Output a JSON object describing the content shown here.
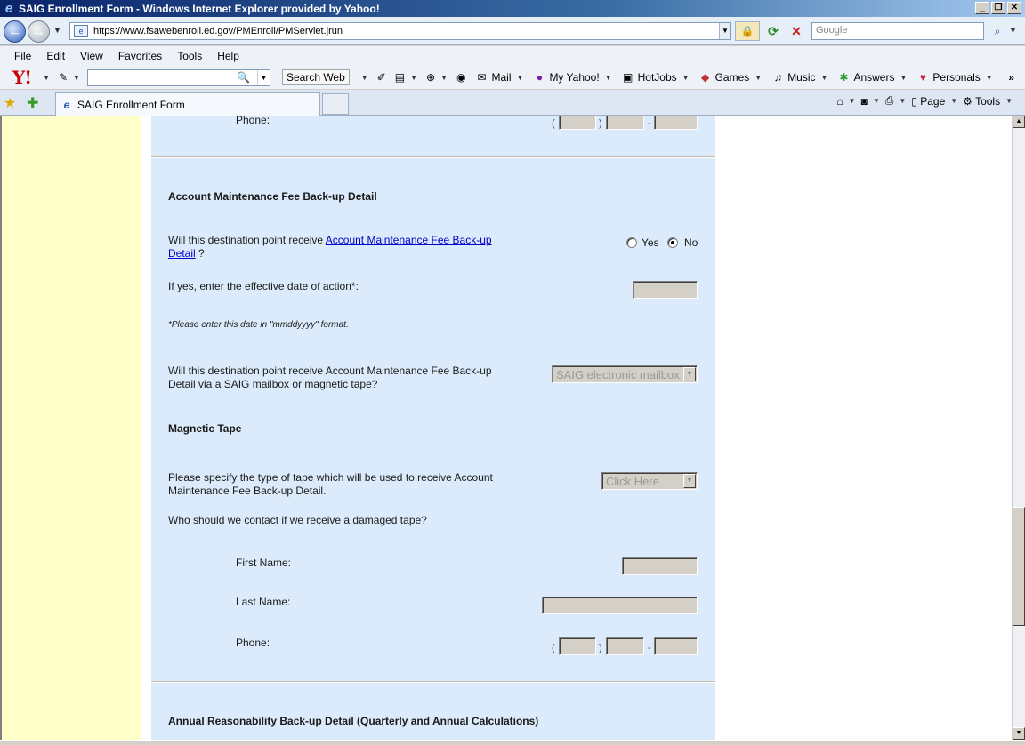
{
  "window": {
    "title": "SAIG Enrollment Form - Windows Internet Explorer provided by Yahoo!"
  },
  "address": {
    "url": "https://www.fsawebenroll.ed.gov/PMEnroll/PMServlet.jrun",
    "search_placeholder": "Google"
  },
  "menu": [
    "File",
    "Edit",
    "View",
    "Favorites",
    "Tools",
    "Help"
  ],
  "yahoo_toolbar": {
    "search_web": "Search Web",
    "mail": "Mail",
    "my_yahoo": "My Yahoo!",
    "hotjobs": "HotJobs",
    "games": "Games",
    "music": "Music",
    "answers": "Answers",
    "personals": "Personals"
  },
  "tab": {
    "label": "SAIG Enrollment Form"
  },
  "command_bar": {
    "page": "Page",
    "tools": "Tools"
  },
  "form": {
    "top_phone_label": "Phone:",
    "amf_heading": "Account Maintenance Fee Back-up Detail",
    "amf_question_prefix": "Will this destination point receive",
    "amf_question_link": "Account Maintenance Fee Back-up Detail",
    "amf_question_suffix": "?",
    "yes_label": "Yes",
    "no_label": "No",
    "selected_option": "No",
    "effective_date_label": "If yes, enter the effective date of action*:",
    "date_note": "*Please enter this date in \"mmddyyyy\" format.",
    "delivery_question": "Will this destination point receive Account Maintenance Fee Back-up Detail via a SAIG mailbox or magnetic tape?",
    "delivery_selected": "SAIG electronic mailbox",
    "magnetic_tape_heading": "Magnetic Tape",
    "tape_type_question": "Please specify the type of tape which will be used to receive Account Maintenance Fee Back-up Detail.",
    "tape_type_selected": "Click Here",
    "damaged_tape_question": "Who should we contact if we receive a damaged tape?",
    "first_name_label": "First Name:",
    "last_name_label": "Last Name:",
    "phone_label": "Phone:",
    "annual_heading": "Annual Reasonability Back-up Detail (Quarterly and Annual Calculations)"
  }
}
